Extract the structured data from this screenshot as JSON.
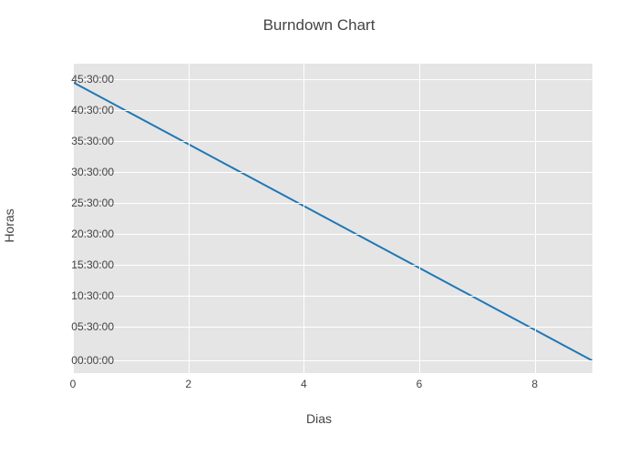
{
  "chart_data": {
    "type": "line",
    "title": "Burndown Chart",
    "xlabel": "Dias",
    "ylabel": "Horas",
    "x": [
      0,
      1,
      2,
      3,
      4,
      5,
      6,
      7,
      8,
      9
    ],
    "y_hours": [
      45,
      40,
      35,
      30,
      25,
      20,
      15,
      10,
      5,
      0
    ],
    "x_ticks": [
      0,
      2,
      4,
      6,
      8
    ],
    "y_ticks": [
      "00:00:00",
      "05:30:00",
      "10:30:00",
      "15:30:00",
      "20:30:00",
      "25:30:00",
      "30:30:00",
      "35:30:00",
      "40:30:00",
      "45:30:00"
    ],
    "y_tick_hours": [
      0,
      5.5,
      10.5,
      15.5,
      20.5,
      25.5,
      30.5,
      35.5,
      40.5,
      45.5
    ],
    "xlim": [
      0,
      9
    ],
    "ylim_hours": [
      -2,
      48
    ],
    "line_color": "#1f77b4"
  }
}
